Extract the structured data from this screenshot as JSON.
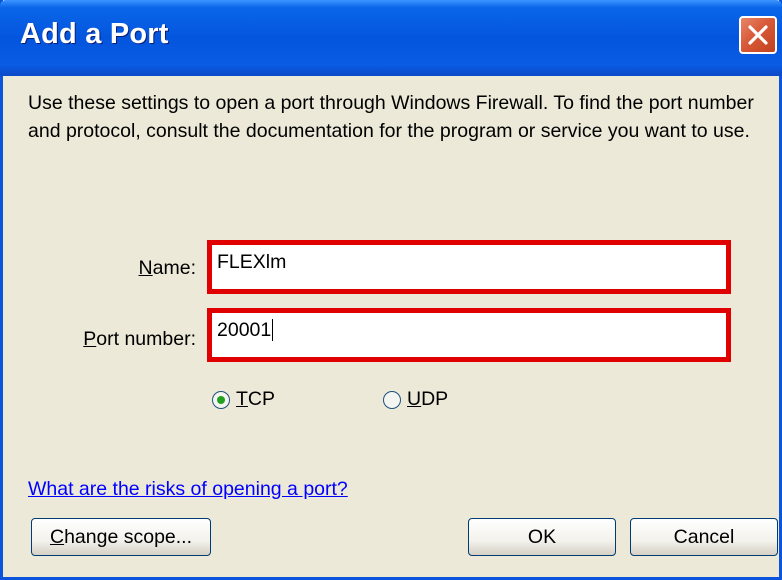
{
  "window": {
    "title": "Add a Port"
  },
  "description": "Use these settings to open a port through Windows Firewall. To find the port number and protocol, consult the documentation for the program or service you want to use.",
  "form": {
    "name": {
      "label_prefix": "",
      "label_mnemonic": "N",
      "label_rest": "ame:",
      "value": "FLEXlm"
    },
    "port": {
      "label_prefix": "",
      "label_mnemonic": "P",
      "label_rest": "ort number:",
      "value": "20001"
    },
    "protocol": {
      "selected": "TCP",
      "options": [
        {
          "mnemonic": "T",
          "rest": "CP",
          "value": "TCP"
        },
        {
          "mnemonic": "U",
          "rest": "DP",
          "value": "UDP"
        }
      ]
    }
  },
  "link": {
    "text": "What are the risks of opening a port?"
  },
  "buttons": {
    "change_scope": {
      "mnemonic": "C",
      "rest": "hange scope..."
    },
    "ok": "OK",
    "cancel": "Cancel"
  },
  "colors": {
    "highlight_border": "#E00000",
    "title_bar": "#0455DE",
    "dialog_bg": "#ECE9D8",
    "link": "#0000FF",
    "radio_selected": "#21A121"
  },
  "icons": {
    "close": "close-icon"
  }
}
